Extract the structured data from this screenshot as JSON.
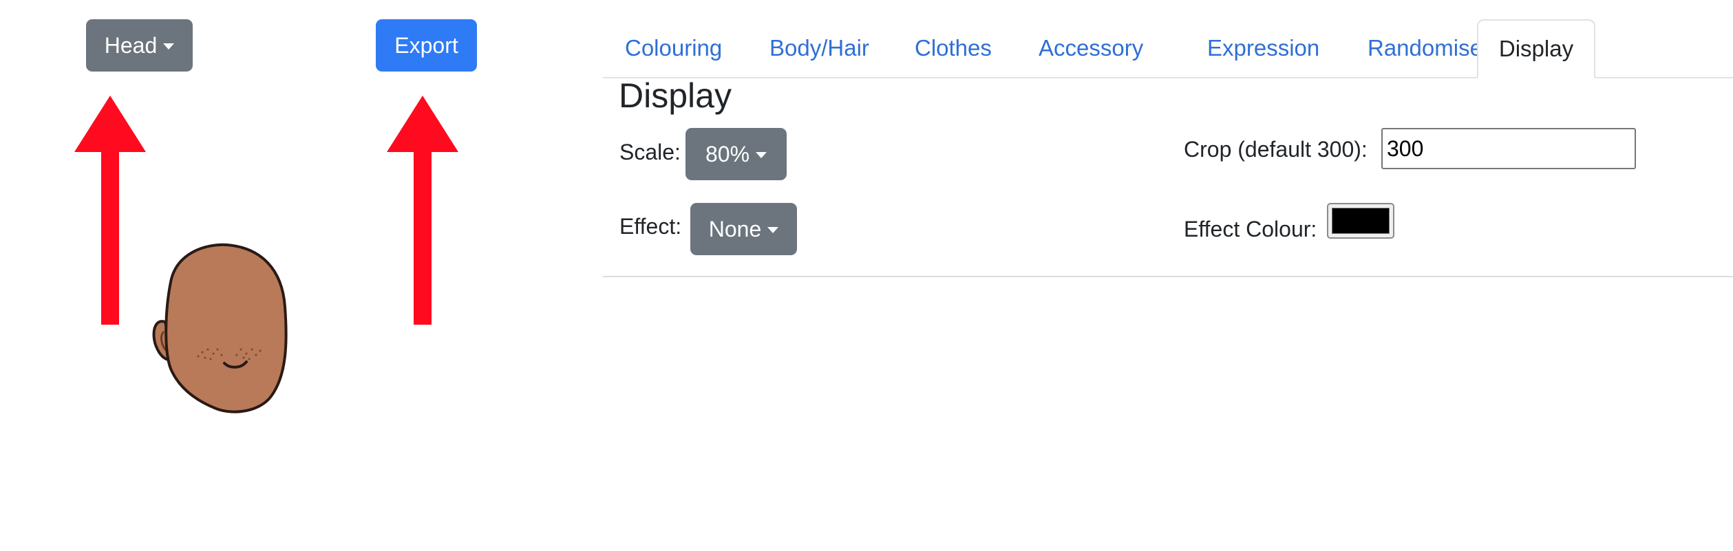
{
  "toolbar": {
    "head_label": "Head",
    "export_label": "Export"
  },
  "tabs": [
    {
      "label": "Colouring",
      "active": false
    },
    {
      "label": "Body/Hair",
      "active": false
    },
    {
      "label": "Clothes",
      "active": false
    },
    {
      "label": "Accessory",
      "active": false
    },
    {
      "label": "Expression",
      "active": false
    },
    {
      "label": "Randomise",
      "active": false
    },
    {
      "label": "Display",
      "active": true
    }
  ],
  "display": {
    "title": "Display",
    "scale_label": "Scale:",
    "scale_value": "80%",
    "effect_label": "Effect:",
    "effect_value": "None",
    "crop_label": "Crop (default 300):",
    "crop_value": "300",
    "effect_colour_label": "Effect Colour:",
    "effect_colour_value": "#000000"
  },
  "colors": {
    "primary": "#2f7bf5",
    "secondary": "#6c757d",
    "tab_link": "#2f6fd6",
    "annotation_arrow": "#ff0a1e",
    "skin": "#b97a5a"
  }
}
